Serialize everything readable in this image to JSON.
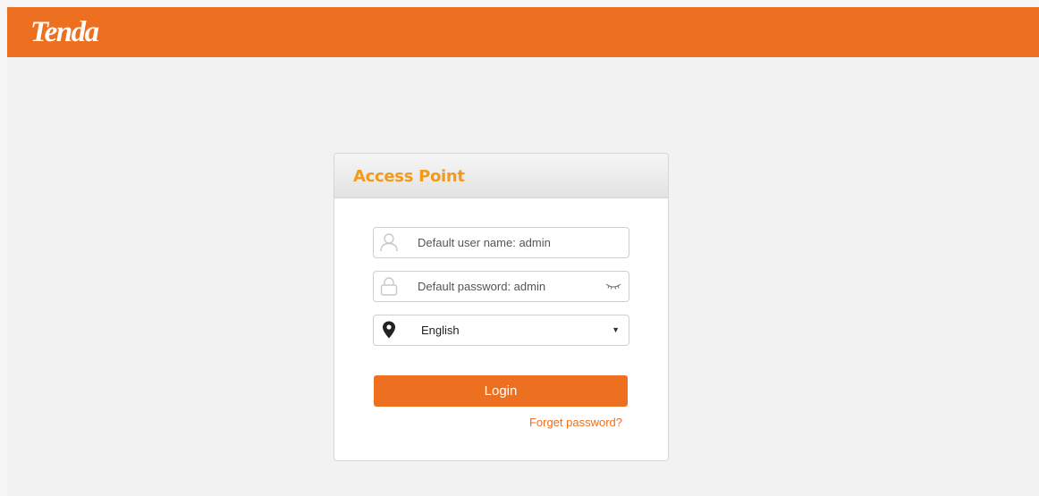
{
  "header": {
    "logo_text": "Tenda",
    "brand_color": "#ed7021"
  },
  "login": {
    "title": "Access Point",
    "username_placeholder": "Default user name: admin",
    "password_placeholder": "Default password: admin",
    "language_selected": "English",
    "login_label": "Login",
    "forget_label": "Forget password?"
  },
  "icons": {
    "user": "user-icon",
    "lock": "lock-icon",
    "eye": "eye-closed-icon",
    "location": "location-pin-icon",
    "dropdown": "caret-down-icon"
  }
}
